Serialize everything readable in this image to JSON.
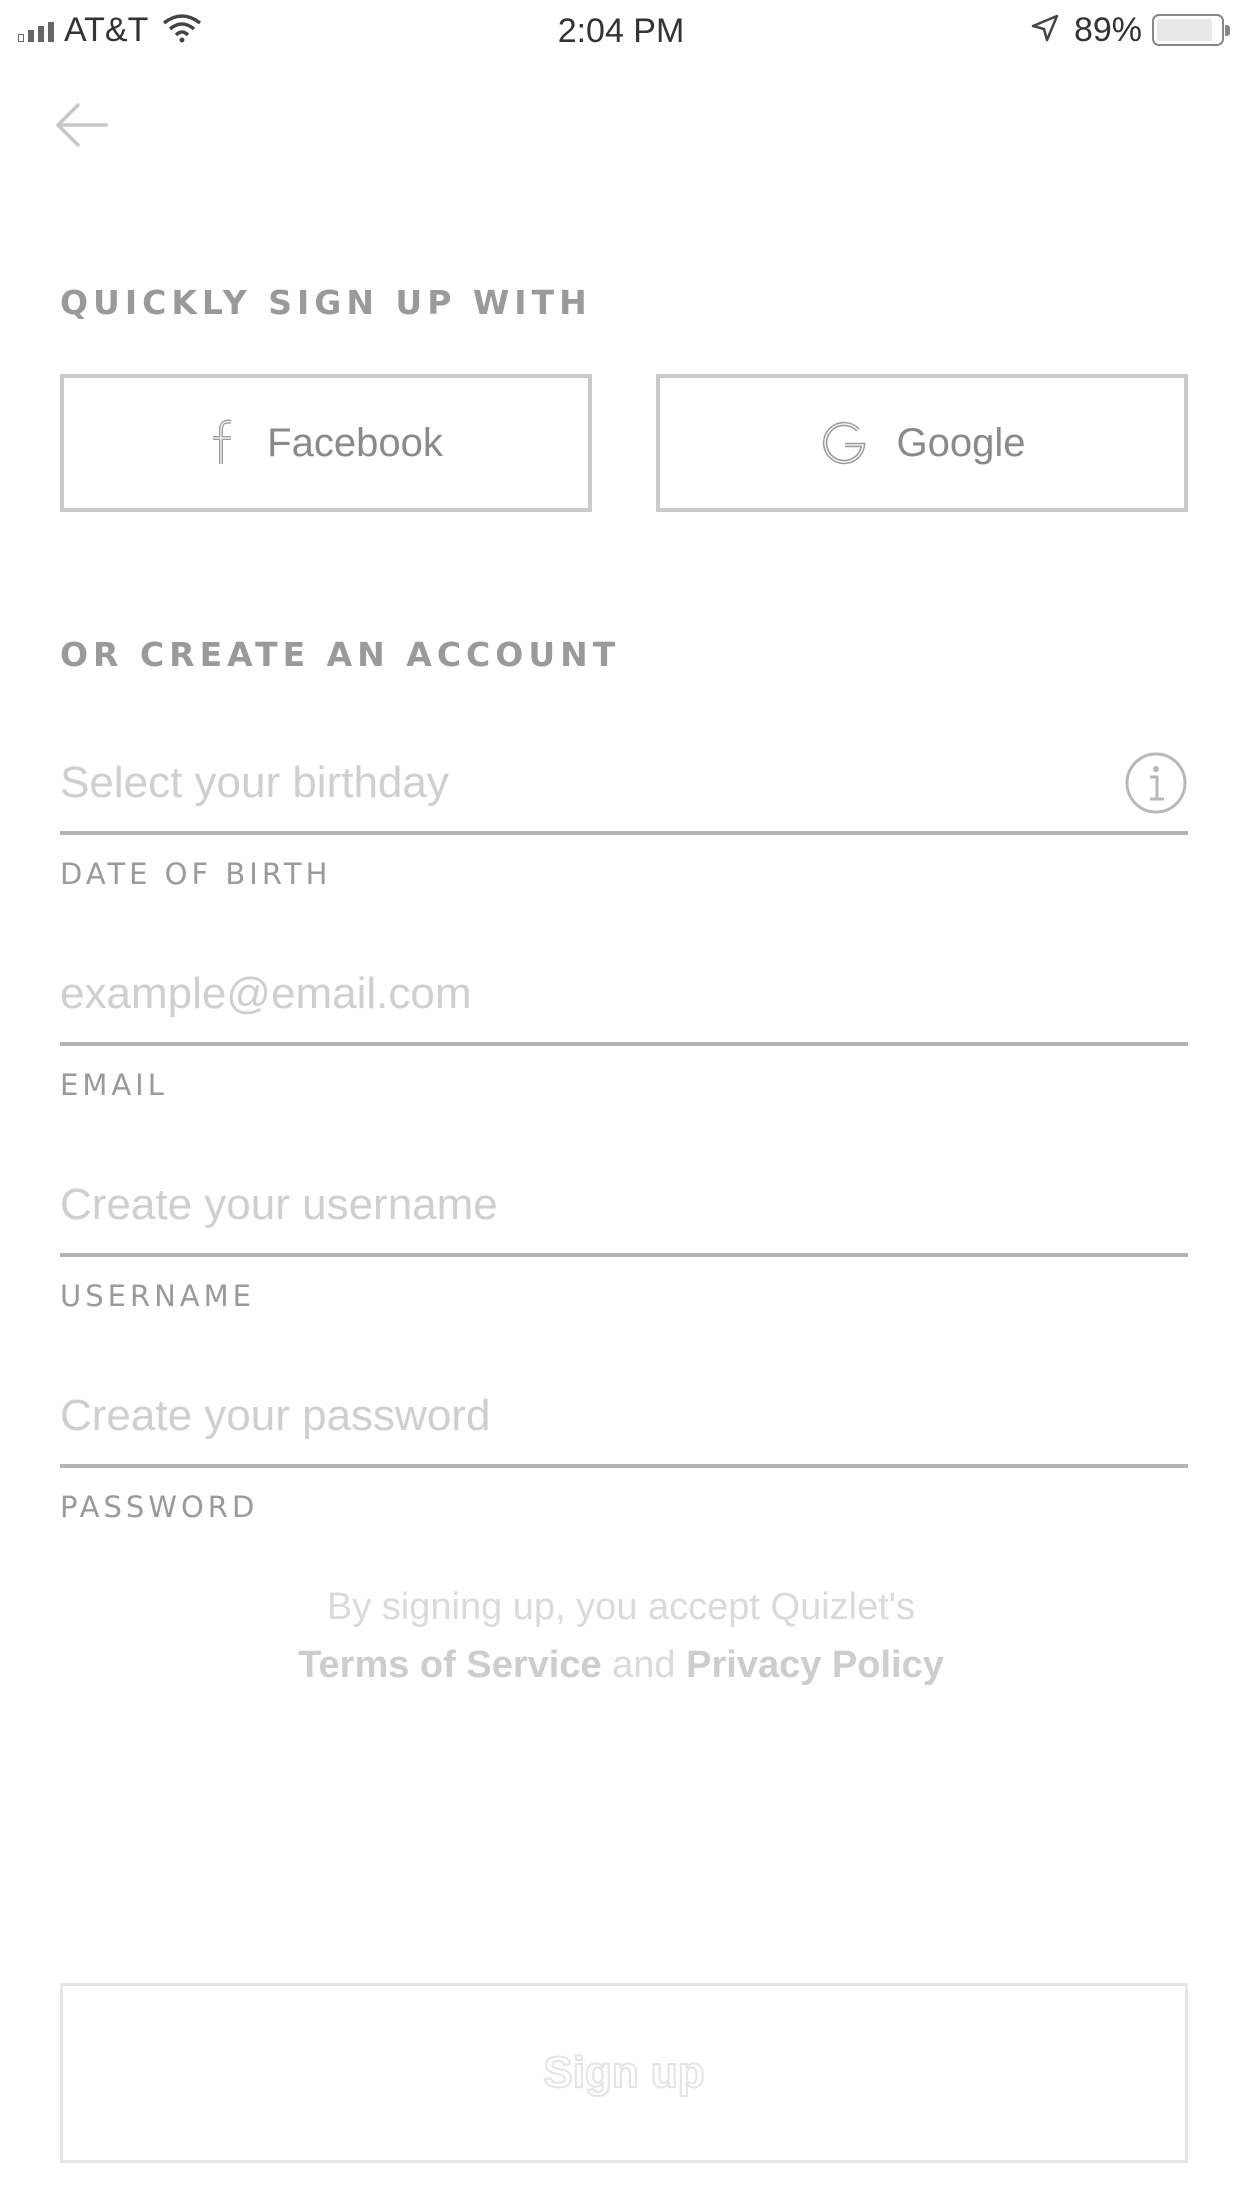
{
  "status_bar": {
    "carrier": "AT&T",
    "time": "2:04 PM",
    "battery_percent": "89%",
    "battery_level": 0.89,
    "signal_icon": "cellular-signal-icon",
    "wifi_icon": "wifi-icon",
    "location_icon": "location-arrow-icon",
    "battery_icon": "battery-icon"
  },
  "nav": {
    "back_icon": "back-arrow-icon"
  },
  "social": {
    "heading": "QUICKLY SIGN UP WITH",
    "facebook_label": "Facebook",
    "facebook_icon": "facebook-icon",
    "google_label": "Google",
    "google_icon": "google-icon"
  },
  "account": {
    "heading": "OR CREATE AN ACCOUNT",
    "fields": [
      {
        "placeholder": "Select your birthday",
        "label": "DATE OF BIRTH",
        "value": ""
      },
      {
        "placeholder": "example@email.com",
        "label": "EMAIL",
        "value": ""
      },
      {
        "placeholder": "Create your username",
        "label": "USERNAME",
        "value": ""
      },
      {
        "placeholder": "Create your password",
        "label": "PASSWORD",
        "value": ""
      }
    ],
    "info_icon": "info-icon"
  },
  "terms": {
    "line1": "By signing up, you accept Quizlet's",
    "terms_link": "Terms of Service",
    "and_text": "and",
    "privacy_link": "Privacy Policy"
  },
  "signup_button": {
    "label": "Sign up"
  },
  "colors": {
    "border": "#c9c9c9",
    "heading": "#9a9a9a",
    "placeholder": "#cfcfcf"
  }
}
